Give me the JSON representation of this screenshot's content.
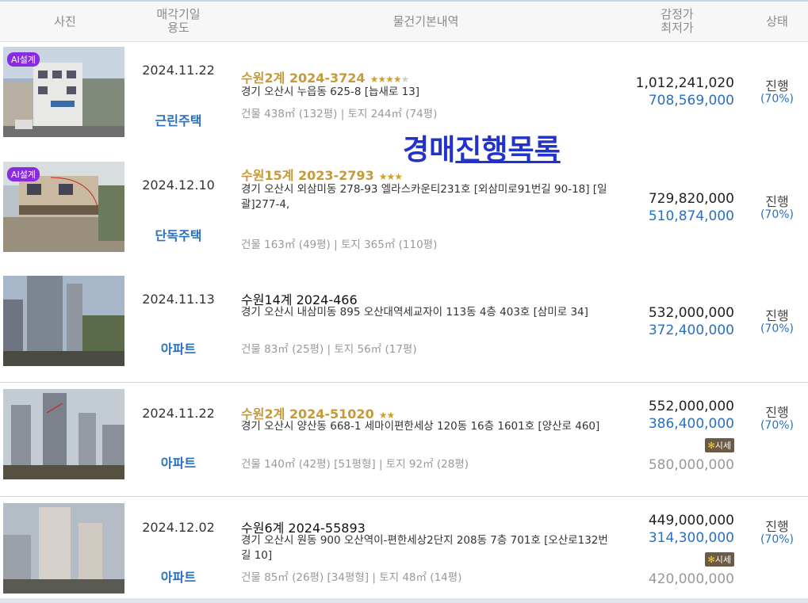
{
  "header": {
    "photo": "사진",
    "date_line1": "매각기일",
    "date_line2": "용도",
    "details": "물건기본내역",
    "price_line1": "감정가",
    "price_line2": "최저가",
    "status": "상태"
  },
  "overlay": {
    "part1": "경매",
    "part2": "진행목록"
  },
  "ai_badge": "AI설계",
  "market_label": "시세",
  "rows": [
    {
      "date": "2024.11.22",
      "usage": "근린주택",
      "case": "수원2계 2024-3724",
      "stars_full": "★★★★",
      "stars_empty": "★",
      "address": "경기 오산시 누읍동 625-8 [늡새로 13]",
      "area": "건물 438㎡ (132평)   |   토지 244㎡ (74평)",
      "appraisal": "1,012,241,020",
      "minimum": "708,569,000",
      "status": "진행",
      "pct": "(70%)"
    },
    {
      "date": "2024.12.10",
      "usage": "단독주택",
      "case": "수원15계 2023-2793",
      "stars_full": "★★★",
      "stars_empty": "",
      "address": "경기 오산시 외삼미동 278-93 엘라스카운티231호 [외삼미로91번길 90-18]  [일괄]277-4,",
      "area": "건물 163㎡ (49평)   |   토지 365㎡ (110평)",
      "appraisal": "729,820,000",
      "minimum": "510,874,000",
      "status": "진행",
      "pct": "(70%)"
    },
    {
      "date": "2024.11.13",
      "usage": "아파트",
      "case": "수원14계 2024-466",
      "stars_full": "",
      "stars_empty": "",
      "address": "경기 오산시 내삼미동 895 오산대역세교자이 113동 4층 403호 [삼미로 34]",
      "area": "건물 83㎡ (25평)   |   토지 56㎡ (17평)",
      "appraisal": "532,000,000",
      "minimum": "372,400,000",
      "status": "진행",
      "pct": "(70%)"
    },
    {
      "date": "2024.11.22",
      "usage": "아파트",
      "case": "수원2계 2024-51020",
      "stars_full": "★★",
      "stars_empty": "",
      "address": "경기 오산시 양산동 668-1 세마이편한세상 120동 16층 1601호 [양산로 460]",
      "area": "건물 140㎡ (42평) [51평형]   |   토지 92㎡ (28평)",
      "appraisal": "552,000,000",
      "minimum": "386,400,000",
      "market": "580,000,000",
      "status": "진행",
      "pct": "(70%)"
    },
    {
      "date": "2024.12.02",
      "usage": "아파트",
      "case": "수원6계 2024-55893",
      "stars_full": "",
      "stars_empty": "",
      "address": "경기 오산시 원동 900 오산역이-편한세상2단지 208동 7층 701호 [오산로132번길 10]",
      "area": "건물 85㎡ (26평) [34평형]   |   토지 48㎡ (14평)",
      "appraisal": "449,000,000",
      "minimum": "314,300,000",
      "market": "420,000,000",
      "status": "진행",
      "pct": "(70%)"
    }
  ]
}
